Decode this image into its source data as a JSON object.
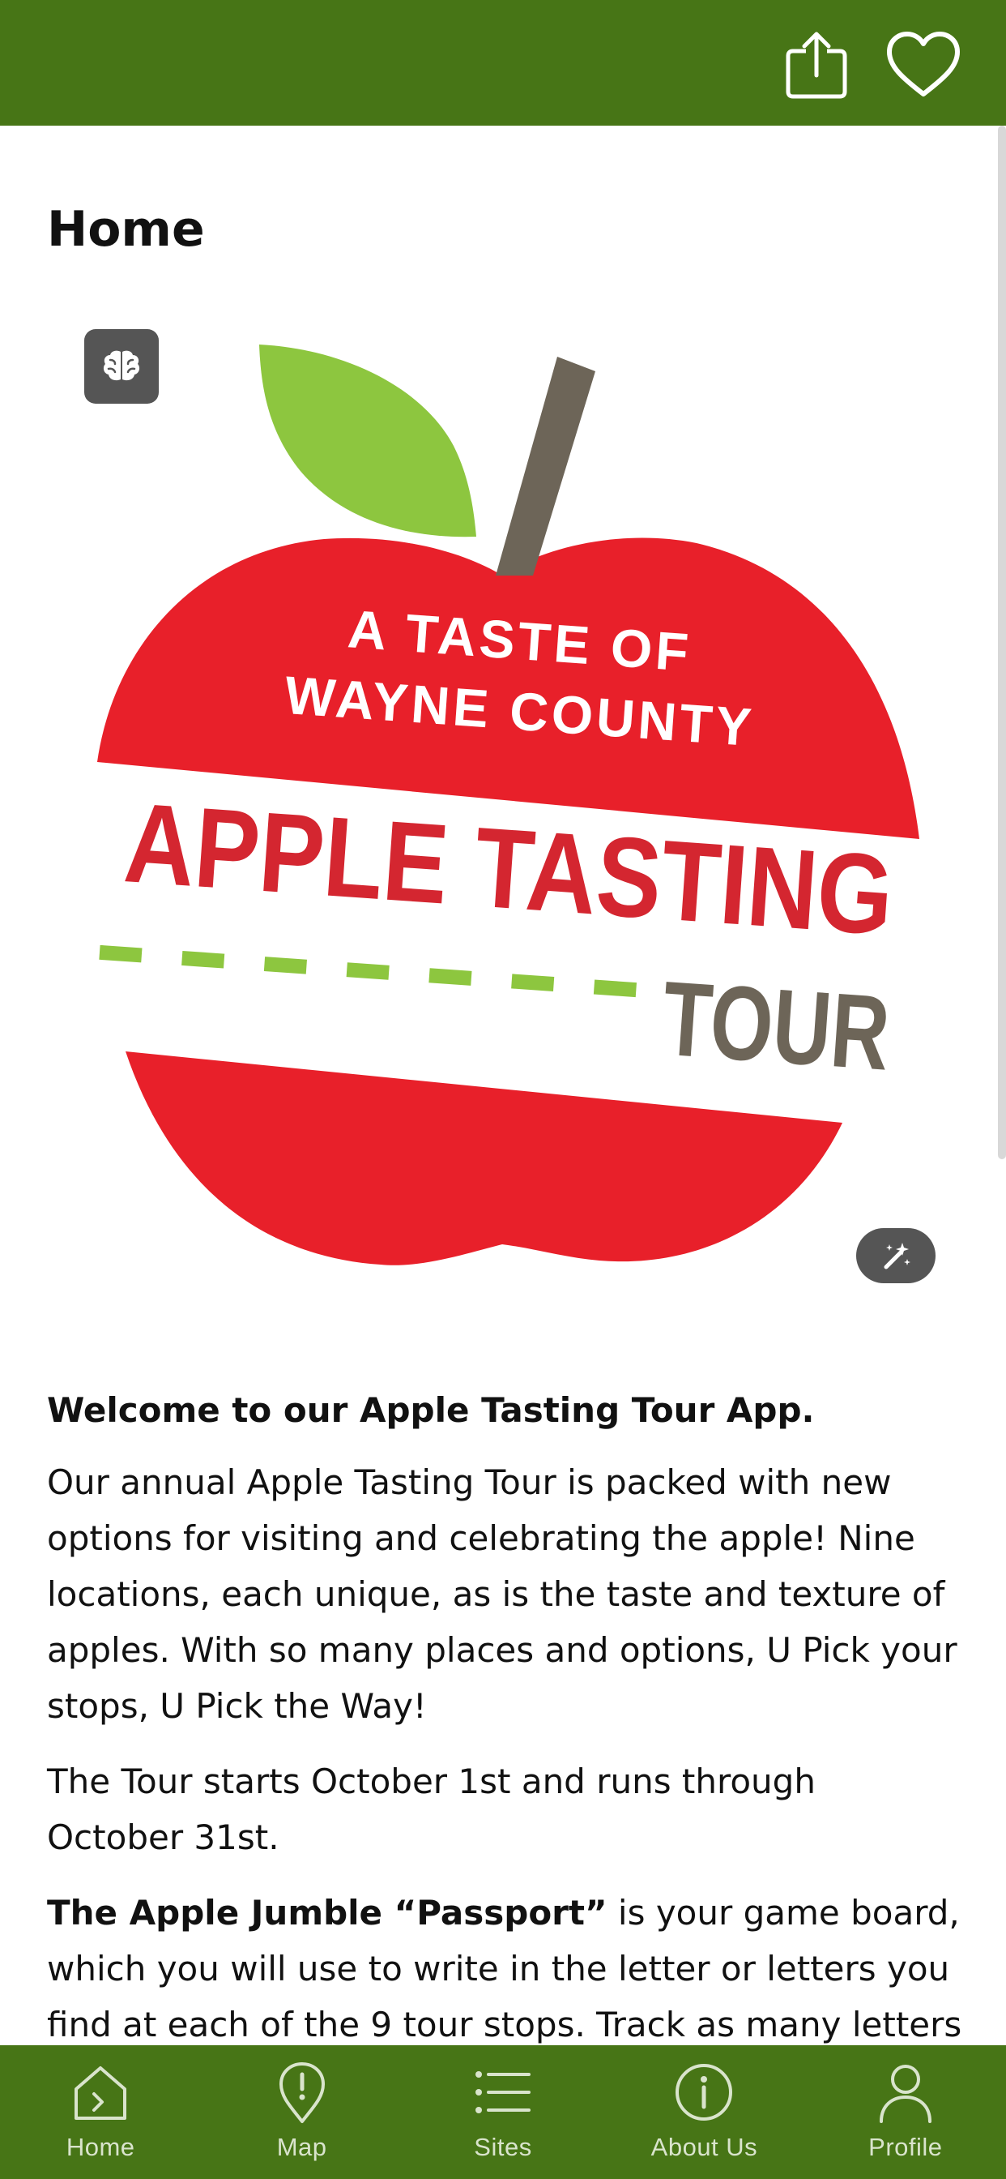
{
  "colors": {
    "header_bg": "#477516",
    "nav_bg": "#477516",
    "nav_text": "#d9e4cc",
    "apple_red": "#e8202a",
    "leaf_green": "#8dc63f",
    "stem_brown": "#6d6558",
    "tour_gray": "#6d6558"
  },
  "header": {
    "share_icon": "share-icon",
    "favorite_icon": "heart-icon"
  },
  "page": {
    "title": "Home"
  },
  "logo": {
    "line1": "A TASTE OF",
    "line2": "WAYNE COUNTY",
    "line3": "APPLE TASTING",
    "line4": "TOUR"
  },
  "content": {
    "welcome": "Welcome to our Apple Tasting Tour App.",
    "para1": "Our annual Apple Tasting Tour is packed with new options for visiting and celebrating the apple! Nine locations, each unique, as is the taste and texture of apples. With so many places and options, U Pick your stops, U Pick the Way!",
    "para2": "The Tour starts October 1st and runs through October 31st.",
    "para3_bold": "The Apple Jumble “Passport”",
    "para3_rest": " is your game board, which you will use to write in the letter or letters you find at each of the 9 tour stops. Track as many letters"
  },
  "nav": {
    "items": [
      {
        "label": "Home",
        "icon": "home-icon"
      },
      {
        "label": "Map",
        "icon": "map-pin-icon"
      },
      {
        "label": "Sites",
        "icon": "list-icon"
      },
      {
        "label": "About Us",
        "icon": "info-icon"
      },
      {
        "label": "Profile",
        "icon": "profile-icon"
      }
    ]
  }
}
